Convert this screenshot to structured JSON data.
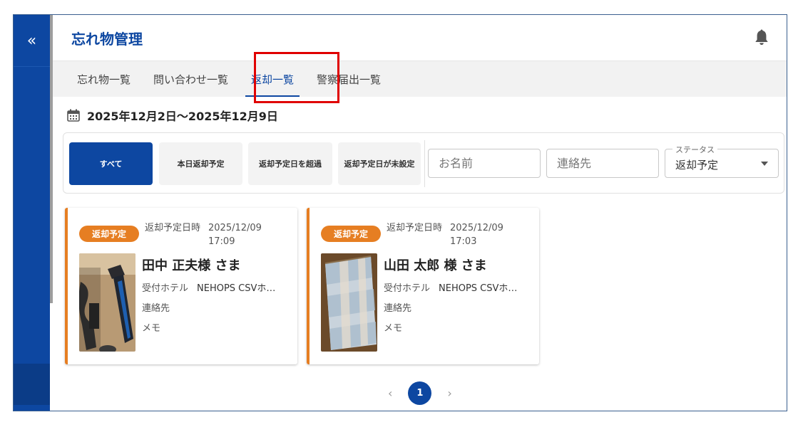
{
  "sidebar": {
    "collapse_label": "«"
  },
  "header": {
    "title": "忘れ物管理"
  },
  "tabs": [
    {
      "label": "忘れ物一覧"
    },
    {
      "label": "問い合わせ一覧"
    },
    {
      "label": "返却一覧"
    },
    {
      "label": "警察届出一覧"
    }
  ],
  "date_range": "2025年12月2日〜2025年12月9日",
  "filters": {
    "buttons": [
      {
        "label": "すべて"
      },
      {
        "label": "本日返却予定"
      },
      {
        "label": "返却予定日を超過"
      },
      {
        "label": "返却予定日が未設定"
      }
    ],
    "name_placeholder": "お名前",
    "contact_placeholder": "連絡先",
    "status_label": "ステータス",
    "status_value": "返却予定"
  },
  "cards": [
    {
      "badge": "返却予定",
      "date_label": "返却予定日時",
      "date": "2025/12/09",
      "time": "17:09",
      "name": "田中 正夫様 さま",
      "hotel_label": "受付ホテル",
      "hotel_value": "NEHOPS CSVホ…",
      "contact_label": "連絡先",
      "memo_label": "メモ"
    },
    {
      "badge": "返却予定",
      "date_label": "返却予定日時",
      "date": "2025/12/09",
      "time": "17:03",
      "name": "山田 太郎 様 さま",
      "hotel_label": "受付ホテル",
      "hotel_value": "NEHOPS CSVホ…",
      "contact_label": "連絡先",
      "memo_label": "メモ"
    }
  ],
  "pagination": {
    "prev": "‹",
    "current": "1",
    "next": "›"
  },
  "colors": {
    "primary": "#0d47a1",
    "badge": "#e67e22",
    "highlight": "#e00000"
  }
}
